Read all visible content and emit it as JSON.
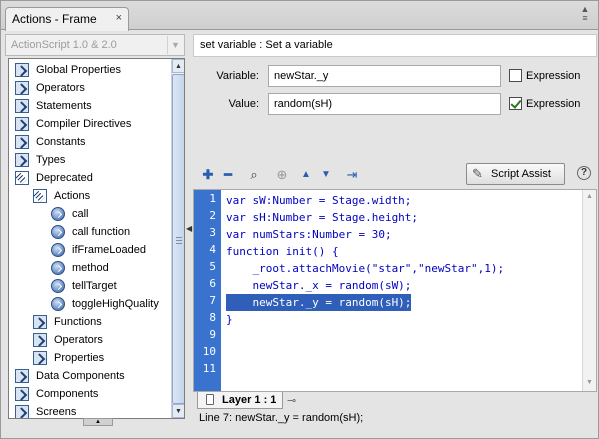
{
  "window": {
    "tab_title": "Actions - Frame",
    "close_glyph": "×",
    "menu_glyph": "≡"
  },
  "left": {
    "version_select": "ActionScript 1.0 & 2.0",
    "tree": [
      {
        "label": "Global Properties",
        "icon": "book-closed-icon",
        "indent": 0
      },
      {
        "label": "Operators",
        "icon": "book-closed-icon",
        "indent": 0
      },
      {
        "label": "Statements",
        "icon": "book-closed-icon",
        "indent": 0
      },
      {
        "label": "Compiler Directives",
        "icon": "book-closed-icon",
        "indent": 0
      },
      {
        "label": "Constants",
        "icon": "book-closed-icon",
        "indent": 0
      },
      {
        "label": "Types",
        "icon": "book-closed-icon",
        "indent": 0
      },
      {
        "label": "Deprecated",
        "icon": "book-open-icon",
        "indent": 0
      },
      {
        "label": "Actions",
        "icon": "book-open-icon",
        "indent": 1
      },
      {
        "label": "call",
        "icon": "action-circle-icon",
        "indent": 2
      },
      {
        "label": "call function",
        "icon": "action-circle-icon",
        "indent": 2
      },
      {
        "label": "ifFrameLoaded",
        "icon": "action-circle-icon",
        "indent": 2
      },
      {
        "label": "method",
        "icon": "action-circle-icon",
        "indent": 2
      },
      {
        "label": "tellTarget",
        "icon": "action-circle-icon",
        "indent": 2
      },
      {
        "label": "toggleHighQuality",
        "icon": "action-circle-icon",
        "indent": 2
      },
      {
        "label": "Functions",
        "icon": "book-closed-icon",
        "indent": 1
      },
      {
        "label": "Operators",
        "icon": "book-closed-icon",
        "indent": 1
      },
      {
        "label": "Properties",
        "icon": "book-closed-icon",
        "indent": 1
      },
      {
        "label": "Data Components",
        "icon": "book-closed-icon",
        "indent": 0
      },
      {
        "label": "Components",
        "icon": "book-closed-icon",
        "indent": 0
      },
      {
        "label": "Screens",
        "icon": "book-closed-icon",
        "indent": 0
      }
    ]
  },
  "right": {
    "description": "set variable : Set a variable",
    "variable_label": "Variable:",
    "variable_value": "newStar._y",
    "variable_expression": false,
    "value_label": "Value:",
    "value_value": "random(sH)",
    "value_expression": true,
    "expression_label": "Expression",
    "script_assist": "Script Assist",
    "help_glyph": "?",
    "code": [
      "var sW:Number = Stage.width;",
      "var sH:Number = Stage.height;",
      "var numStars:Number = 30;",
      "function init() {",
      "    _root.attachMovie(\"star\",\"newStar\",1);",
      "    newStar._x = random(sW);",
      "    newStar._y = random(sH);",
      "}"
    ],
    "line_numbers": [
      "1",
      "2",
      "3",
      "4",
      "5",
      "6",
      "7",
      "8",
      "9",
      "10",
      "11"
    ],
    "selected_line": 7,
    "layer_tab": "Layer 1 : 1",
    "status": "Line 7: newStar._y = random(sH);"
  },
  "colors": {
    "gutter": "#3a73ce",
    "selection": "#2f5fb9",
    "code": "#0000c0"
  }
}
